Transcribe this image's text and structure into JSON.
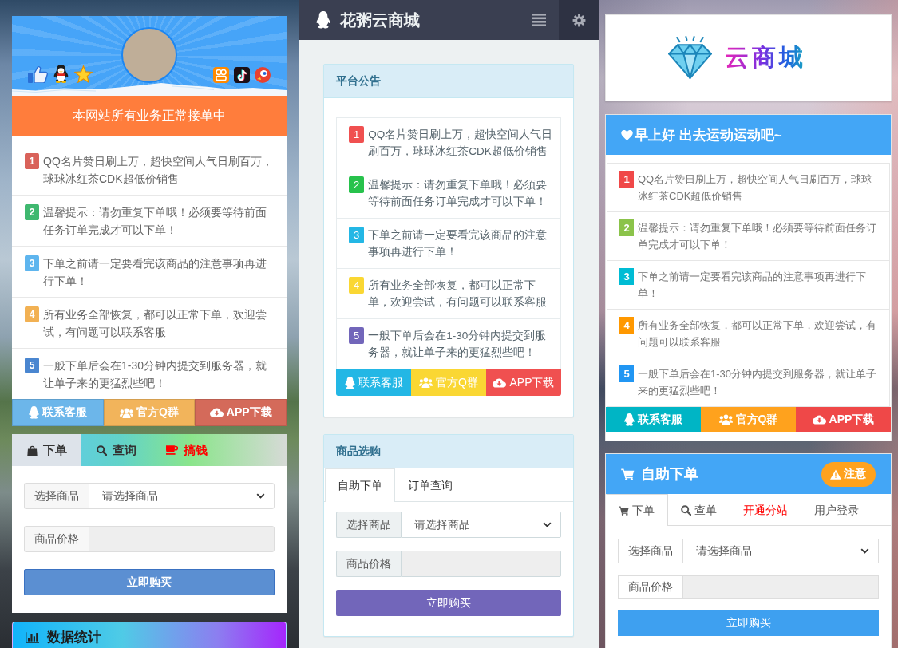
{
  "left_column": {
    "status_banner": "本网站所有业务正常接单中",
    "notices": [
      {
        "number": "1",
        "color": "#d9625a",
        "text": "QQ名片赞日刷上万，超快空间人气日刷百万，球球冰红茶CDK超低价销售"
      },
      {
        "number": "2",
        "color": "#3fb86f",
        "text": "温馨提示：请勿重复下单哦！必须要等待前面任务订单完成才可以下单！"
      },
      {
        "number": "3",
        "color": "#5eb5ee",
        "text": "下单之前请一定要看完该商品的注意事项再进行下单！"
      },
      {
        "number": "4",
        "color": "#f2b153",
        "text": "所有业务全部恢复，都可以正常下单，欢迎尝试，有问题可以联系客服"
      },
      {
        "number": "5",
        "color": "#4a86d0",
        "text": "一般下单后会在1-30分钟内提交到服务器，就让单子来的更猛烈些吧！"
      }
    ],
    "buttons": [
      {
        "kind": "service",
        "label": "联系客服",
        "color": "#6cb6ea"
      },
      {
        "kind": "group",
        "label": "官方Q群",
        "color": "#f2b45b"
      },
      {
        "kind": "download",
        "label": "APP下载",
        "color": "#d46a5a"
      }
    ],
    "order_card": {
      "tabs": [
        {
          "kind": "order",
          "label": "下单",
          "selected": true
        },
        {
          "kind": "query",
          "label": "查询",
          "selected": false
        },
        {
          "kind": "money",
          "label": "搞钱",
          "selected": false,
          "color": "#ff0000"
        }
      ],
      "form": {
        "fields": [
          {
            "kind": "select",
            "label": "选择商品",
            "value": "请选择商品",
            "disabled": false
          },
          {
            "kind": "input",
            "label": "商品价格",
            "disabled": true
          }
        ],
        "submit": "立即购买"
      }
    },
    "stats_card": {
      "title": "数据统计"
    }
  },
  "middle_column": {
    "header": {
      "title": "花粥云商城"
    },
    "notice_panel": {
      "title": "平台公告",
      "notices": [
        {
          "number": "1",
          "color": "#f05050",
          "text": "QQ名片赞日刷上万，超快空间人气日刷百万，球球冰红茶CDK超低价销售"
        },
        {
          "number": "2",
          "color": "#27c24c",
          "text": "温馨提示：请勿重复下单哦！必须要等待前面任务订单完成才可以下单！"
        },
        {
          "number": "3",
          "color": "#23b7e5",
          "text": "下单之前请一定要看完该商品的注意事项再进行下单！"
        },
        {
          "number": "4",
          "color": "#fad733",
          "text": "所有业务全部恢复，都可以正常下单，欢迎尝试，有问题可以联系客服"
        },
        {
          "number": "5",
          "color": "#7266ba",
          "text": "一般下单后会在1-30分钟内提交到服务器，就让单子来的更猛烈些吧！"
        }
      ],
      "buttons": [
        {
          "kind": "service",
          "label": "联系客服",
          "color": "#23b7e5"
        },
        {
          "kind": "group",
          "label": "官方Q群",
          "color": "#fad733"
        },
        {
          "kind": "download",
          "label": "APP下载",
          "color": "#f05050"
        }
      ]
    },
    "shop_panel": {
      "title": "商品选购",
      "tabs": [
        {
          "label": "自助下单",
          "selected": true
        },
        {
          "label": "订单查询",
          "selected": false
        }
      ],
      "form": {
        "fields": [
          {
            "kind": "select",
            "label": "选择商品",
            "value": "请选择商品",
            "disabled": false
          },
          {
            "kind": "input",
            "label": "商品价格",
            "disabled": true
          }
        ],
        "submit": "立即购买"
      }
    }
  },
  "right_column": {
    "logo": {
      "text": "云商城"
    },
    "greeting_panel": {
      "title": "早上好 出去运动运动吧~",
      "notices": [
        {
          "number": "1",
          "color": "#f04848",
          "text": "QQ名片赞日刷上万，超快空间人气日刷百万，球球冰红茶CDK超低价销售"
        },
        {
          "number": "2",
          "color": "#8bc34a",
          "text": "温馨提示：请勿重复下单哦！必须要等待前面任务订单完成才可以下单！"
        },
        {
          "number": "3",
          "color": "#00bcd4",
          "text": "下单之前请一定要看完该商品的注意事项再进行下单！"
        },
        {
          "number": "4",
          "color": "#ff9800",
          "text": "所有业务全部恢复，都可以正常下单，欢迎尝试，有问题可以联系客服"
        },
        {
          "number": "5",
          "color": "#2196f3",
          "text": "一般下单后会在1-30分钟内提交到服务器，就让单子来的更猛烈些吧！"
        }
      ],
      "buttons": [
        {
          "kind": "service",
          "label": "联系客服",
          "color": "#00b5c5"
        },
        {
          "kind": "group",
          "label": "官方Q群",
          "color": "#ffa21d"
        },
        {
          "kind": "download",
          "label": "APP下载",
          "color": "#ef4848"
        }
      ]
    },
    "order_panel": {
      "title": "自助下单",
      "badge": "注意",
      "tabs": [
        {
          "kind": "order",
          "label": "下单",
          "selected": true
        },
        {
          "kind": "query",
          "label": "查单",
          "selected": false
        },
        {
          "kind": "plain",
          "label": "开通分站",
          "selected": false,
          "color": "#ff0000"
        },
        {
          "kind": "plain",
          "label": "用户登录",
          "selected": false
        }
      ],
      "form": {
        "fields": [
          {
            "kind": "select",
            "label": "选择商品",
            "value": "请选择商品",
            "disabled": false
          },
          {
            "kind": "input",
            "label": "商品价格",
            "disabled": true
          }
        ],
        "submit": "立即购买"
      }
    }
  }
}
